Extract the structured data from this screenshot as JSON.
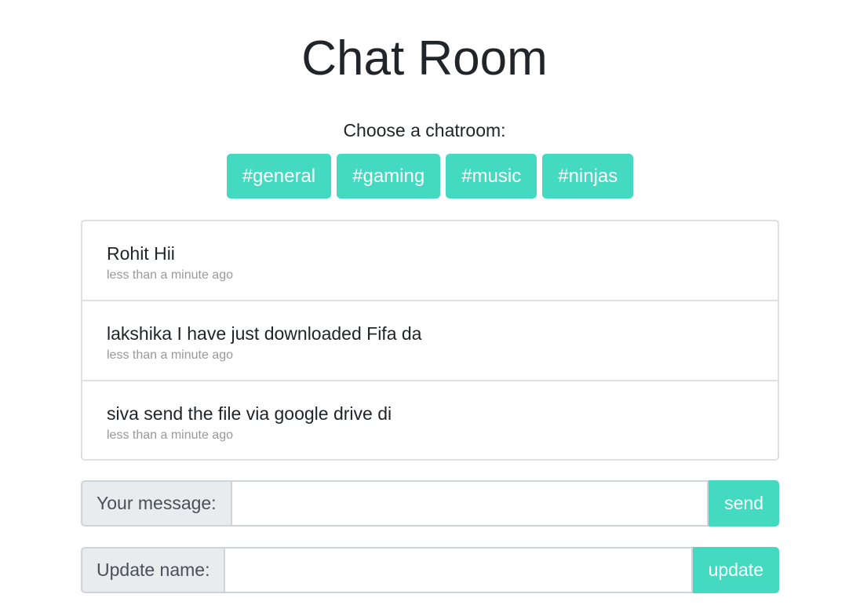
{
  "title": "Chat Room",
  "choose_label": "Choose a chatroom:",
  "rooms": [
    "#general",
    "#gaming",
    "#music",
    "#ninjas"
  ],
  "messages": [
    {
      "text": "Rohit Hii",
      "time": "less than a minute ago"
    },
    {
      "text": "lakshika I have just downloaded Fifa da",
      "time": "less than a minute ago"
    },
    {
      "text": "siva send the file via google drive di",
      "time": "less than a minute ago"
    }
  ],
  "message_form": {
    "label": "Your message:",
    "value": "",
    "button": "send"
  },
  "name_form": {
    "label": "Update name:",
    "value": "",
    "button": "update"
  },
  "colors": {
    "accent": "#43dac1"
  }
}
